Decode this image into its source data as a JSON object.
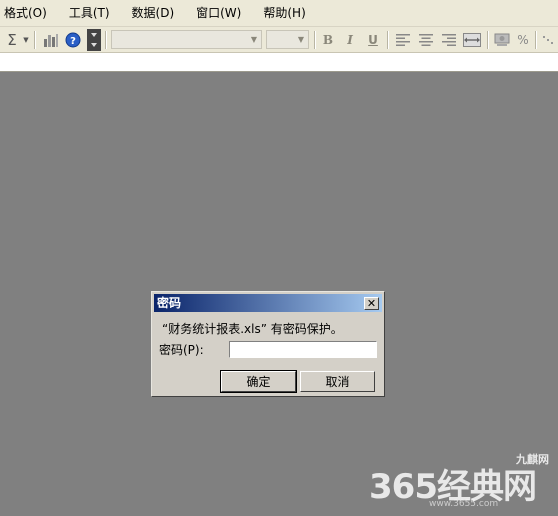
{
  "menu": [
    "格式(O)",
    "工具(T)",
    "数据(D)",
    "窗口(W)",
    "帮助(H)"
  ],
  "toolbar": {
    "sigma": "Σ",
    "bold": "B",
    "italic": "I",
    "underline": "U",
    "percent": "%",
    "help": "?"
  },
  "dialog": {
    "title": "密码",
    "close": "✕",
    "message": "“财务统计报表.xls” 有密码保护。",
    "label": "密码(P):",
    "password_value": "",
    "ok": "确定",
    "cancel": "取消"
  },
  "watermark": {
    "brand": "365经典网",
    "small": "九麒网",
    "url": "www.3655.com"
  }
}
